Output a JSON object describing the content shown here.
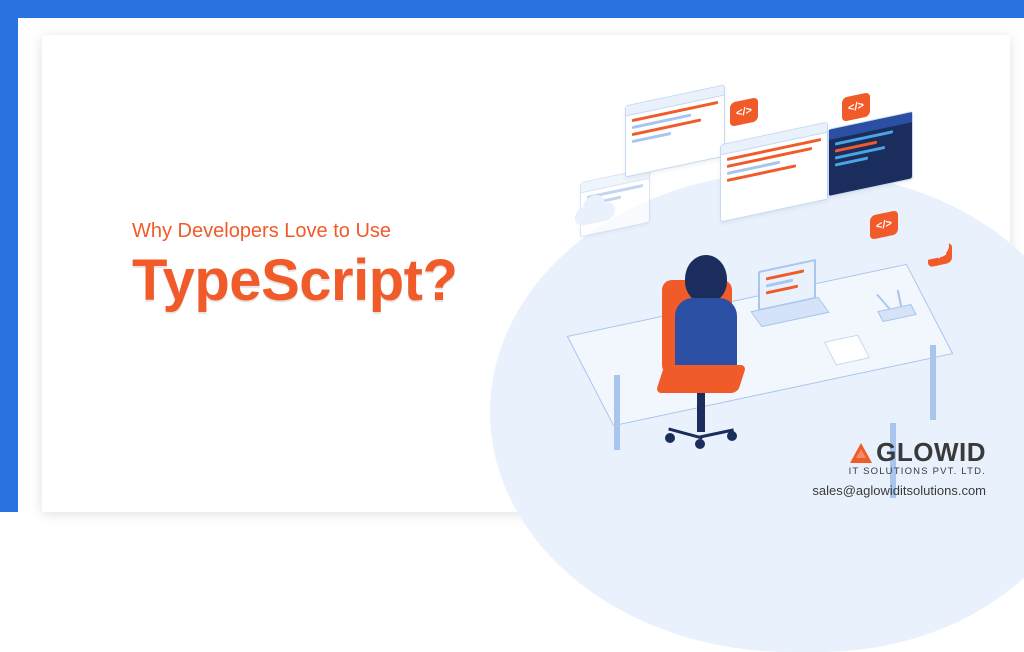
{
  "hero": {
    "subtitle": "Why Developers Love to Use",
    "title": "TypeScript?"
  },
  "branding": {
    "logo_name": "GLOWID",
    "tagline": "IT SOLUTIONS PVT. LTD.",
    "email": "sales@aglowiditsolutions.com"
  },
  "badges": {
    "code_symbol": "</>"
  }
}
